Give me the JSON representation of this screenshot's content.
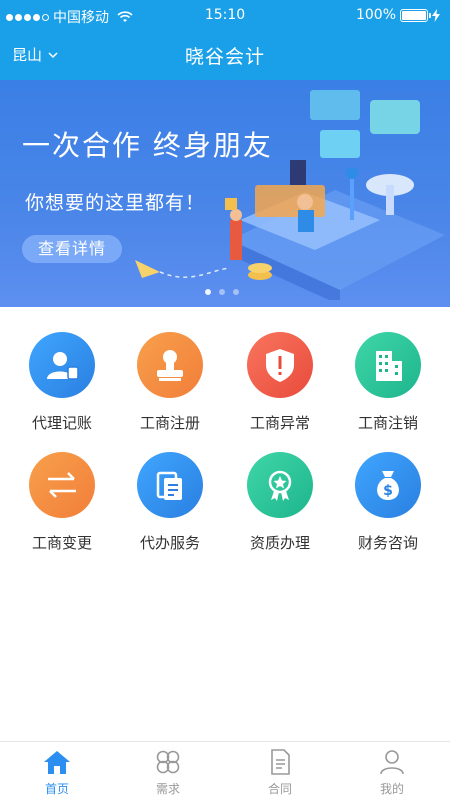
{
  "status_bar": {
    "carrier": "中国移动",
    "time": "15:10",
    "battery": "100%"
  },
  "navbar": {
    "city": "昆山",
    "title": "晓谷会计"
  },
  "banner": {
    "headline": "一次合作  终身朋友",
    "subline": "你想要的这里都有！",
    "cta": "查看详情"
  },
  "services": [
    {
      "label": "代理记账",
      "icon": "accountant-icon",
      "color": "#2f8ef0"
    },
    {
      "label": "工商注册",
      "icon": "stamp-icon",
      "color": "#f28a3e"
    },
    {
      "label": "工商异常",
      "icon": "shield-alert-icon",
      "color": "#ee5a45"
    },
    {
      "label": "工商注销",
      "icon": "building-icon",
      "color": "#28c398"
    },
    {
      "label": "工商变更",
      "icon": "exchange-icon",
      "color": "#f28a3e"
    },
    {
      "label": "代办服务",
      "icon": "documents-icon",
      "color": "#2f8ef0"
    },
    {
      "label": "资质办理",
      "icon": "badge-icon",
      "color": "#28c398"
    },
    {
      "label": "财务咨询",
      "icon": "money-bag-icon",
      "color": "#2f8ef0"
    }
  ],
  "tabs": [
    {
      "label": "首页",
      "icon": "home-icon",
      "active": true
    },
    {
      "label": "需求",
      "icon": "clover-icon",
      "active": false
    },
    {
      "label": "合同",
      "icon": "contract-icon",
      "active": false
    },
    {
      "label": "我的",
      "icon": "profile-icon",
      "active": false
    }
  ]
}
